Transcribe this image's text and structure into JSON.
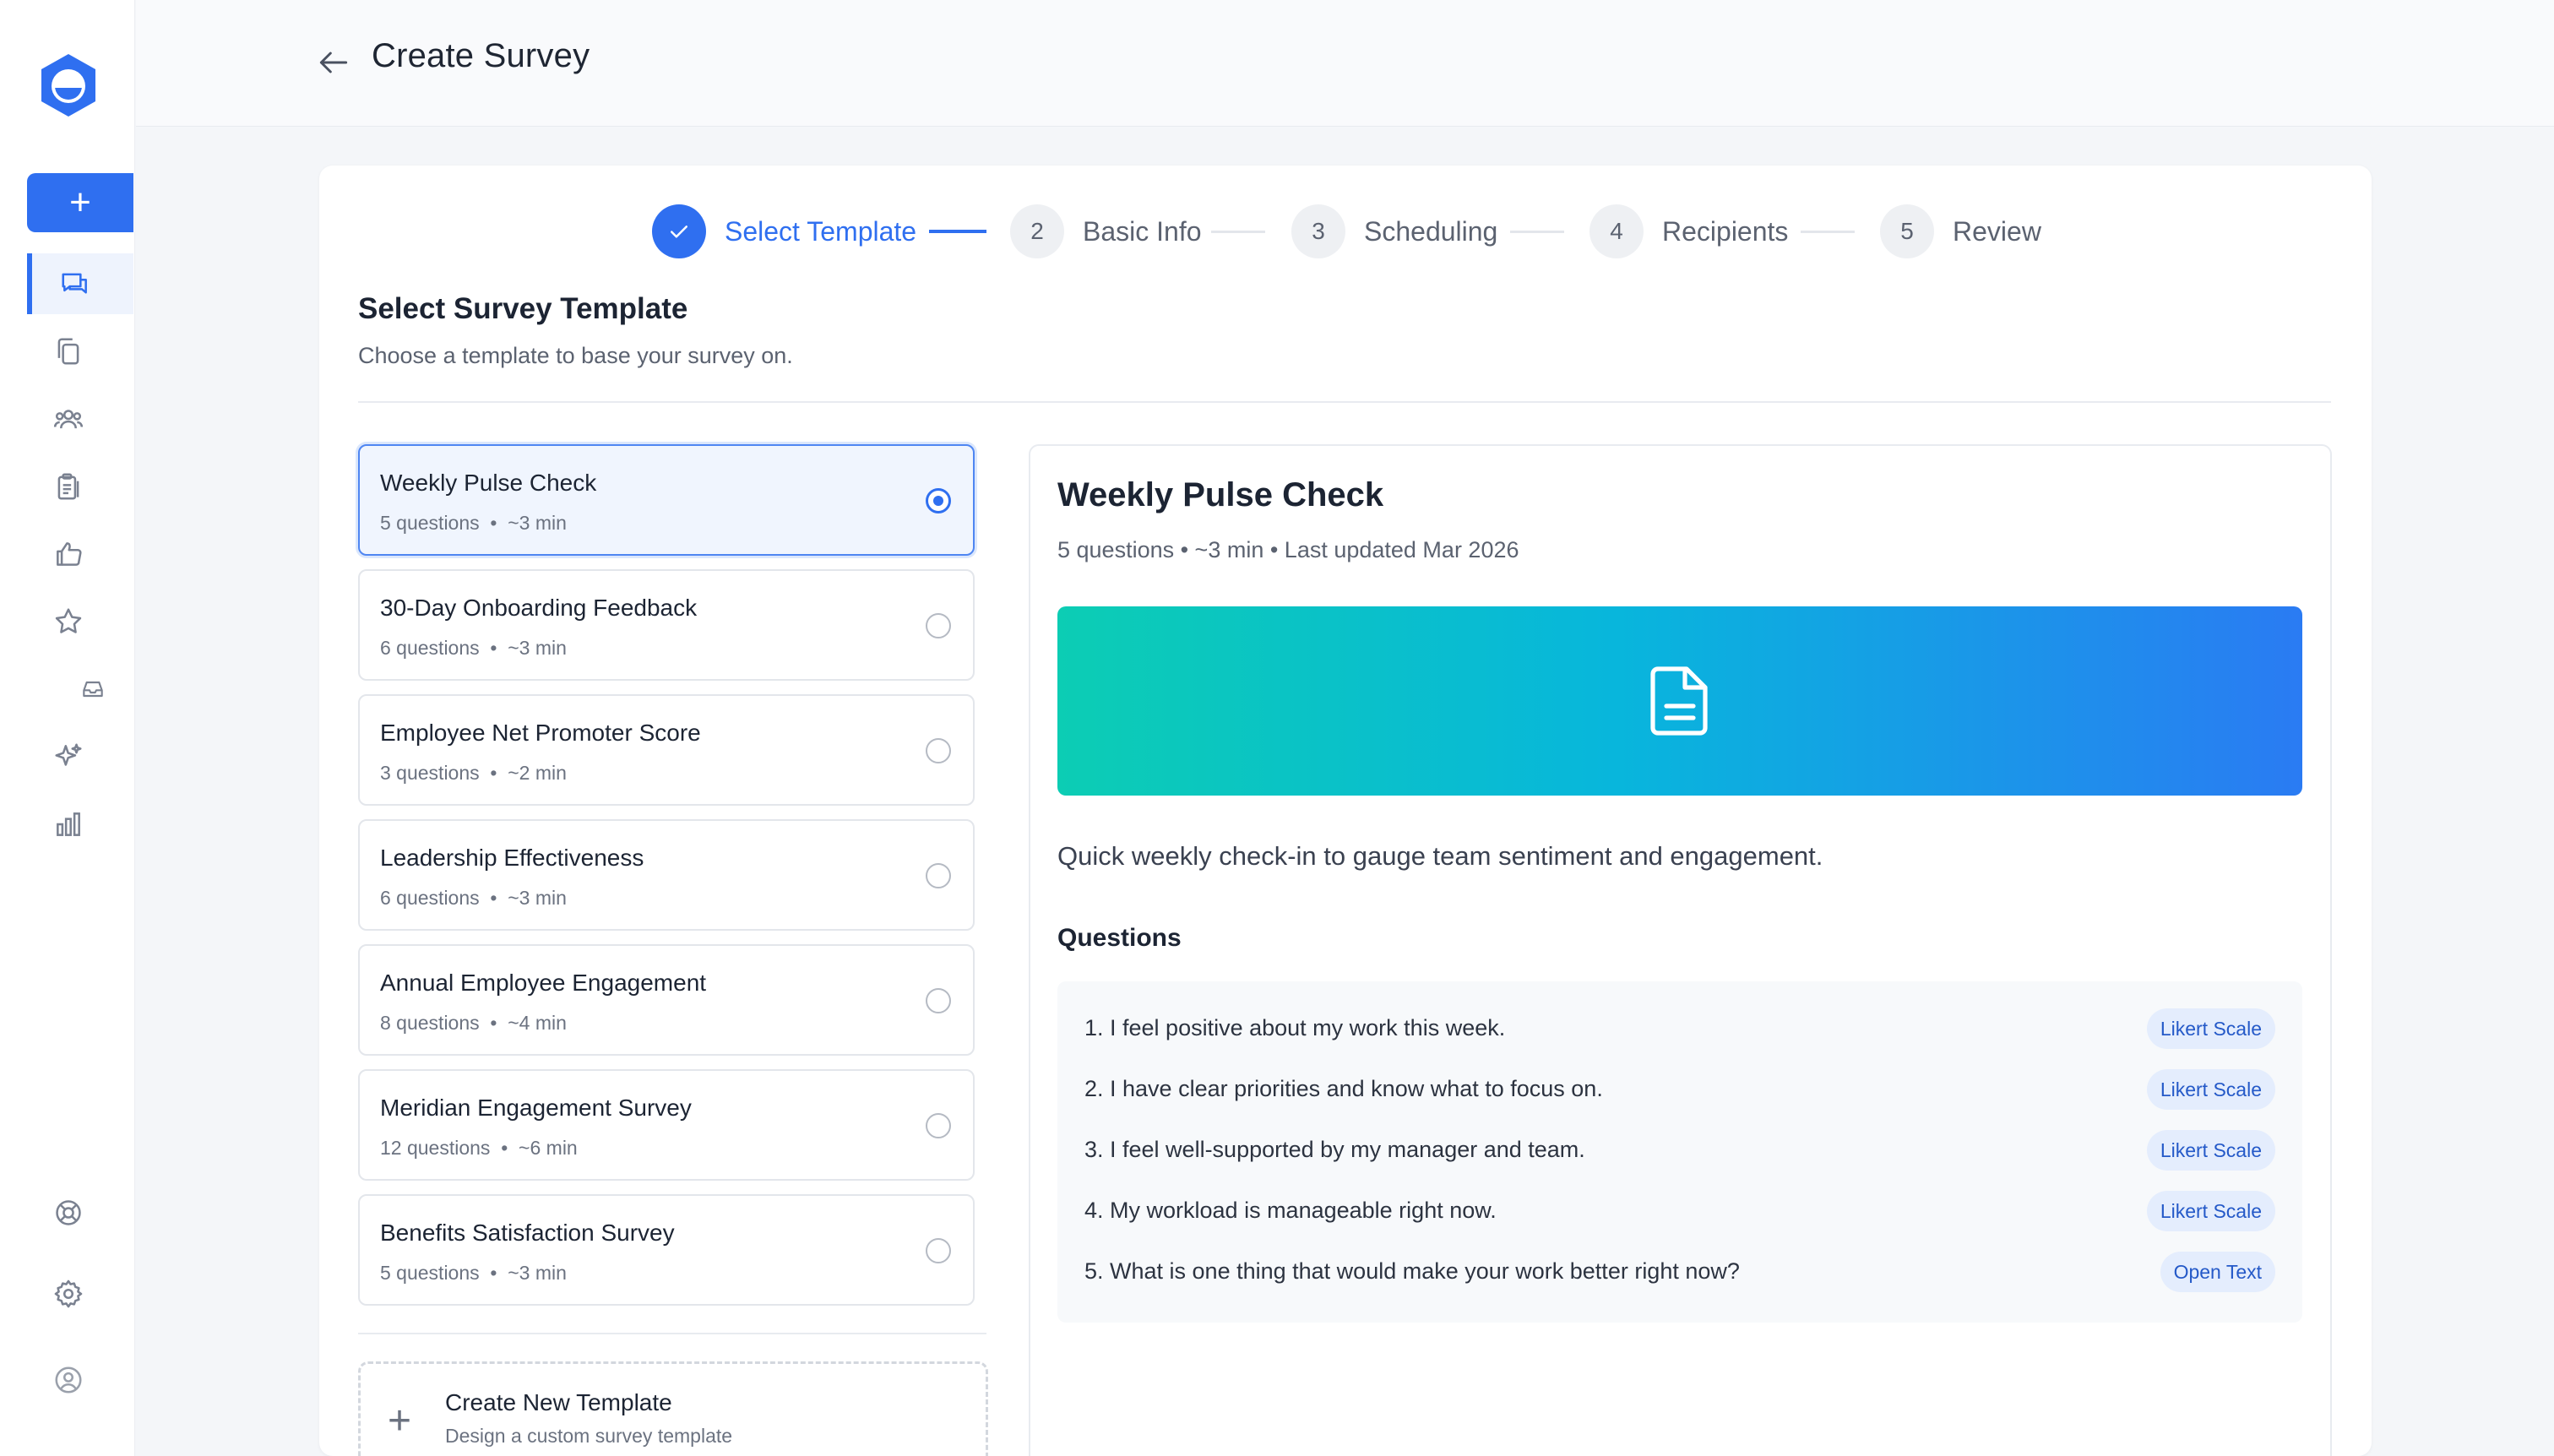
{
  "header": {
    "title": "Create Survey"
  },
  "sidebar": {
    "new_label": "+",
    "items": [
      {
        "name": "surveys",
        "icon": "chat-bubbles-icon",
        "active": true
      },
      {
        "name": "documents",
        "icon": "copy-icon"
      },
      {
        "name": "people",
        "icon": "users-icon"
      },
      {
        "name": "reports",
        "icon": "clipboard-icon"
      },
      {
        "name": "recognition",
        "icon": "thumbs-up-icon"
      },
      {
        "name": "favorites",
        "icon": "star-icon"
      },
      {
        "name": "inbox",
        "icon": "inbox-icon"
      },
      {
        "name": "ai",
        "icon": "sparkles-icon"
      },
      {
        "name": "analytics",
        "icon": "bar-chart-icon"
      },
      {
        "name": "help",
        "icon": "lifebuoy-icon"
      },
      {
        "name": "settings",
        "icon": "gear-icon"
      },
      {
        "name": "profile",
        "icon": "user-circle-icon"
      }
    ]
  },
  "stepper": {
    "steps": [
      {
        "number": "✓",
        "label": "Select Template",
        "state": "current"
      },
      {
        "number": "2",
        "label": "Basic Info",
        "state": "upcoming"
      },
      {
        "number": "3",
        "label": "Scheduling",
        "state": "upcoming"
      },
      {
        "number": "4",
        "label": "Recipients",
        "state": "upcoming"
      },
      {
        "number": "5",
        "label": "Review",
        "state": "upcoming"
      }
    ]
  },
  "section": {
    "title": "Select Survey Template",
    "subtitle": "Choose a template to base your survey on."
  },
  "templates": [
    {
      "name": "Weekly Pulse Check",
      "meta": "5 questions  •  ~3 min",
      "selected": true
    },
    {
      "name": "30-Day Onboarding Feedback",
      "meta": "6 questions  •  ~3 min",
      "selected": false
    },
    {
      "name": "Employee Net Promoter Score",
      "meta": "3 questions  •  ~2 min",
      "selected": false
    },
    {
      "name": "Leadership Effectiveness",
      "meta": "6 questions  •  ~3 min",
      "selected": false
    },
    {
      "name": "Annual Employee Engagement",
      "meta": "8 questions  •  ~4 min",
      "selected": false
    },
    {
      "name": "Meridian Engagement Survey",
      "meta": "12 questions  •  ~6 min",
      "selected": false
    },
    {
      "name": "Benefits Satisfaction Survey",
      "meta": "5 questions  •  ~3 min",
      "selected": false
    }
  ],
  "create_template": {
    "label": "Create New Template",
    "sublabel": "Design a custom survey template"
  },
  "preview": {
    "title": "Weekly Pulse Check",
    "meta": "5 questions • ~3 min • Last updated Mar 2026",
    "banner_icon": "document-icon",
    "description": "Quick weekly check-in to gauge team sentiment and engagement.",
    "questions_heading": "Questions",
    "questions": [
      {
        "text": "1. I feel positive about my work this week.",
        "type": "Likert Scale"
      },
      {
        "text": "2. I have clear priorities and know what to focus on.",
        "type": "Likert Scale"
      },
      {
        "text": "3. I feel well-supported by my manager and team.",
        "type": "Likert Scale"
      },
      {
        "text": "4. My workload is manageable right now.",
        "type": "Likert Scale"
      },
      {
        "text": "5. What is one thing that would make your work better right now?",
        "type": "Open Text"
      }
    ]
  },
  "colors": {
    "accent": "#2f6ff0",
    "banner_start": "#0ccdb4",
    "banner_end": "#2a7bf3",
    "tag_bg": "#e4edfd"
  }
}
